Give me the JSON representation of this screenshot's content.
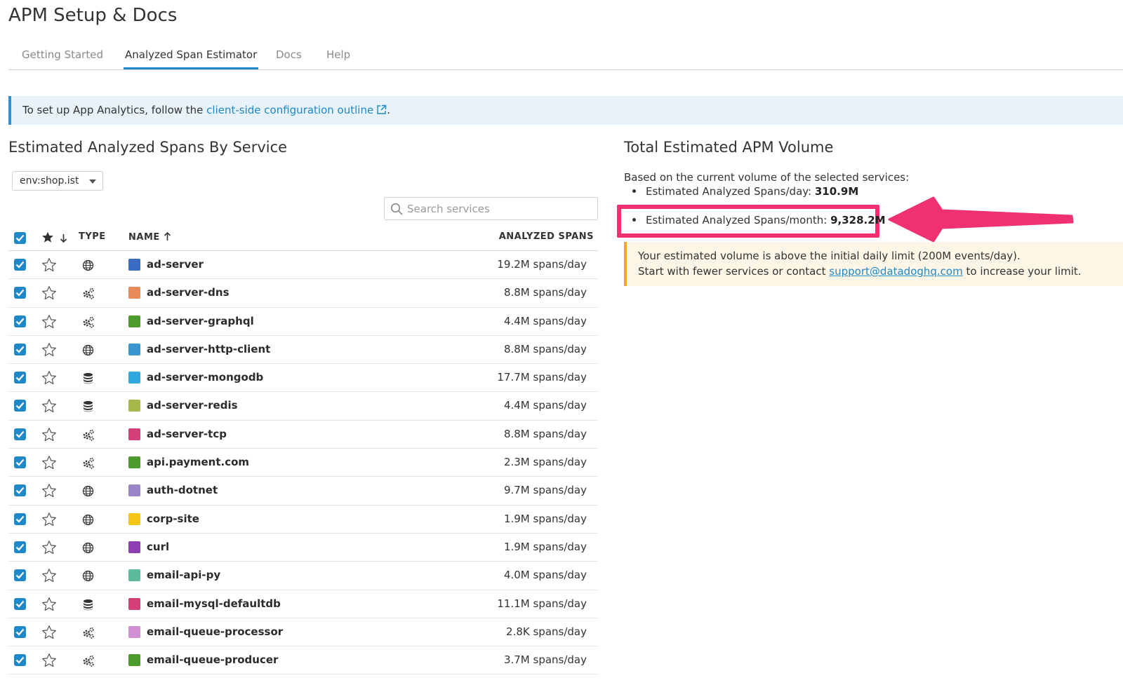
{
  "app": {
    "title": "APM Setup & Docs"
  },
  "tabs": [
    {
      "label": "Getting Started",
      "active": false
    },
    {
      "label": "Analyzed Span Estimator",
      "active": true
    },
    {
      "label": "Docs",
      "active": false
    },
    {
      "label": "Help",
      "active": false
    }
  ],
  "banner": {
    "prefix": "To set up App Analytics, follow the ",
    "link_text": "client-side configuration outline",
    "suffix": "."
  },
  "left": {
    "title": "Estimated Analyzed Spans By Service",
    "env_filter": "env:shop.ist",
    "search_placeholder": "Search services",
    "columns": {
      "type": "TYPE",
      "name": "NAME",
      "spans": "ANALYZED SPANS"
    }
  },
  "services": [
    {
      "name": "ad-server",
      "type": "web",
      "color": "#3b6cc4",
      "spans": "19.2M spans/day"
    },
    {
      "name": "ad-server-dns",
      "type": "custom",
      "color": "#e8895a",
      "spans": "8.8M spans/day"
    },
    {
      "name": "ad-server-graphql",
      "type": "custom",
      "color": "#4f9a2c",
      "spans": "4.4M spans/day"
    },
    {
      "name": "ad-server-http-client",
      "type": "web",
      "color": "#3a96d0",
      "spans": "8.8M spans/day"
    },
    {
      "name": "ad-server-mongodb",
      "type": "db",
      "color": "#2fa8e0",
      "spans": "17.7M spans/day"
    },
    {
      "name": "ad-server-redis",
      "type": "db",
      "color": "#a6b84a",
      "spans": "4.4M spans/day"
    },
    {
      "name": "ad-server-tcp",
      "type": "custom",
      "color": "#d43f78",
      "spans": "8.8M spans/day"
    },
    {
      "name": "api.payment.com",
      "type": "custom",
      "color": "#4f9a2c",
      "spans": "2.3M spans/day"
    },
    {
      "name": "auth-dotnet",
      "type": "web",
      "color": "#9b85c8",
      "spans": "9.7M spans/day"
    },
    {
      "name": "corp-site",
      "type": "web",
      "color": "#f5c518",
      "spans": "1.9M spans/day"
    },
    {
      "name": "curl",
      "type": "web",
      "color": "#8e3eb3",
      "spans": "1.9M spans/day"
    },
    {
      "name": "email-api-py",
      "type": "web",
      "color": "#5bbb9a",
      "spans": "4.0M spans/day"
    },
    {
      "name": "email-mysql-defaultdb",
      "type": "db",
      "color": "#d43f78",
      "spans": "11.1M spans/day"
    },
    {
      "name": "email-queue-processor",
      "type": "custom",
      "color": "#d08fd0",
      "spans": "2.8K spans/day"
    },
    {
      "name": "email-queue-producer",
      "type": "custom",
      "color": "#4f9a2c",
      "spans": "3.7M spans/day"
    }
  ],
  "right": {
    "title": "Total Estimated APM Volume",
    "description": "Based on the current volume of the selected services:",
    "per_day_label": "Estimated Analyzed Spans/day: ",
    "per_day_value": "310.9M",
    "per_month_label": "Estimated Analyzed Spans/month: ",
    "per_month_value": "9,328.2M",
    "warning_line1": "Your estimated volume is above the initial daily limit (200M events/day).",
    "warning_prefix": "Start with fewer services or contact ",
    "warning_link": "support@datadoghq.com",
    "warning_suffix": " to increase your limit."
  },
  "colors": {
    "accent": "#1e88c8",
    "highlight": "#f0316f",
    "warning_border": "#f5a623"
  }
}
